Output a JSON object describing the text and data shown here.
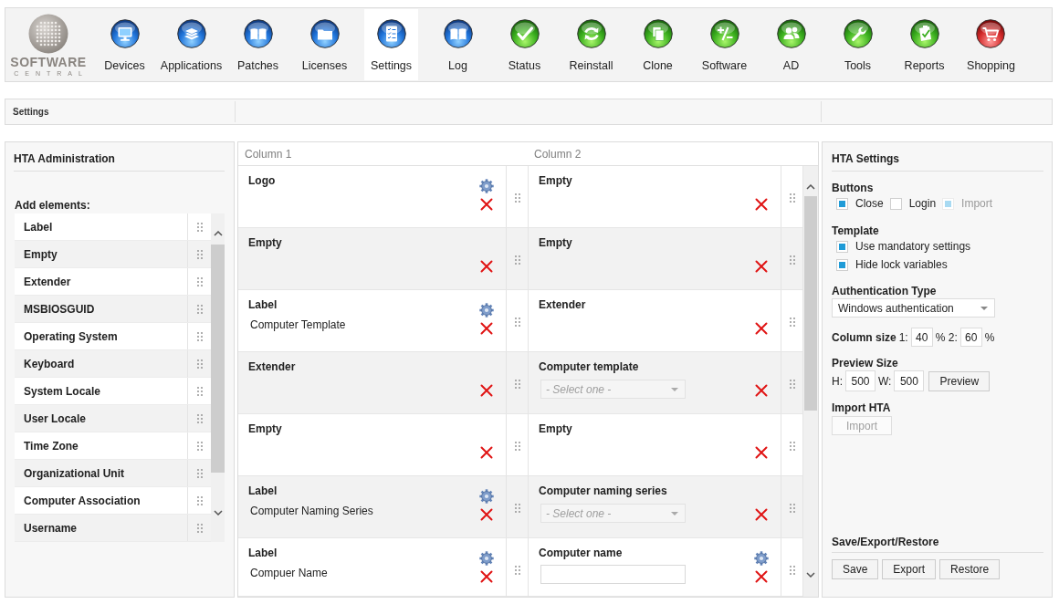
{
  "toolbar": {
    "logo": {
      "title": "SOFTWARE",
      "subtitle": "CENTRAL"
    },
    "items": [
      {
        "label": "Devices",
        "selected": false
      },
      {
        "label": "Applications",
        "selected": false
      },
      {
        "label": "Patches",
        "selected": false
      },
      {
        "label": "Licenses",
        "selected": false
      },
      {
        "label": "Settings",
        "selected": true
      },
      {
        "label": "Log",
        "selected": false
      },
      {
        "label": "Status",
        "selected": false
      },
      {
        "label": "Reinstall",
        "selected": false
      },
      {
        "label": "Clone",
        "selected": false
      },
      {
        "label": "Software",
        "selected": false
      },
      {
        "label": "AD",
        "selected": false
      },
      {
        "label": "Tools",
        "selected": false
      },
      {
        "label": "Reports",
        "selected": false
      },
      {
        "label": "Shopping",
        "selected": false
      }
    ]
  },
  "breadcrumb": {
    "title": "Settings"
  },
  "admin_panel": {
    "title": "HTA Administration",
    "list_label": "Add elements:",
    "elements": [
      "Label",
      "Empty",
      "Extender",
      "MSBIOSGUID",
      "Operating System",
      "Keyboard",
      "System Locale",
      "User Locale",
      "Time Zone",
      "Organizational Unit",
      "Computer Association",
      "Username"
    ]
  },
  "layout_panel": {
    "columns": [
      "Column 1",
      "Column 2"
    ],
    "rows": [
      {
        "cells": [
          {
            "kind": "plain",
            "title": "Logo",
            "configurable": true
          },
          {
            "kind": "plain",
            "title": "Empty",
            "configurable": false
          }
        ]
      },
      {
        "cells": [
          {
            "kind": "plain",
            "title": "Empty",
            "configurable": false
          },
          {
            "kind": "plain",
            "title": "Empty",
            "configurable": false
          }
        ]
      },
      {
        "cells": [
          {
            "kind": "label",
            "title": "Label",
            "text": "Computer Template",
            "configurable": true
          },
          {
            "kind": "plain",
            "title": "Extender",
            "configurable": false
          }
        ]
      },
      {
        "cells": [
          {
            "kind": "plain",
            "title": "Extender",
            "configurable": false
          },
          {
            "kind": "select",
            "title": "Computer template",
            "placeholder": "- Select one -",
            "configurable": false
          }
        ]
      },
      {
        "cells": [
          {
            "kind": "plain",
            "title": "Empty",
            "configurable": false
          },
          {
            "kind": "plain",
            "title": "Empty",
            "configurable": false
          }
        ]
      },
      {
        "cells": [
          {
            "kind": "label",
            "title": "Label",
            "text": "Computer Naming Series",
            "configurable": true
          },
          {
            "kind": "select",
            "title": "Computer naming series",
            "placeholder": "- Select one -",
            "configurable": false
          }
        ]
      },
      {
        "cells": [
          {
            "kind": "label",
            "title": "Label",
            "text": "Compuer Name",
            "configurable": true
          },
          {
            "kind": "input",
            "title": "Computer name",
            "configurable": true
          }
        ]
      }
    ]
  },
  "settings_panel": {
    "title": "HTA Settings",
    "buttons_group": {
      "heading": "Buttons",
      "options": [
        {
          "label": "Close",
          "checked": true,
          "disabled": false
        },
        {
          "label": "Login",
          "checked": false,
          "disabled": false
        },
        {
          "label": "Import",
          "checked": true,
          "disabled": true
        }
      ]
    },
    "template_group": {
      "heading": "Template",
      "options": [
        {
          "label": "Use mandatory settings",
          "checked": true
        },
        {
          "label": "Hide lock variables",
          "checked": true
        }
      ]
    },
    "authentication": {
      "heading": "Authentication Type",
      "value": "Windows authentication"
    },
    "column_size": {
      "heading": "Column size",
      "label_1": "1:",
      "value_1": "40",
      "label_2": "% 2:",
      "value_2": "60",
      "unit": "%"
    },
    "preview_size": {
      "heading": "Preview Size",
      "height_label": "H:",
      "height_value": "500",
      "width_label": "W:",
      "width_value": "500",
      "button": "Preview"
    },
    "import_hta": {
      "heading": "Import HTA",
      "button": "Import",
      "disabled": true
    },
    "save_export_restore": {
      "heading": "Save/Export/Restore",
      "buttons": [
        "Save",
        "Export",
        "Restore"
      ]
    }
  }
}
